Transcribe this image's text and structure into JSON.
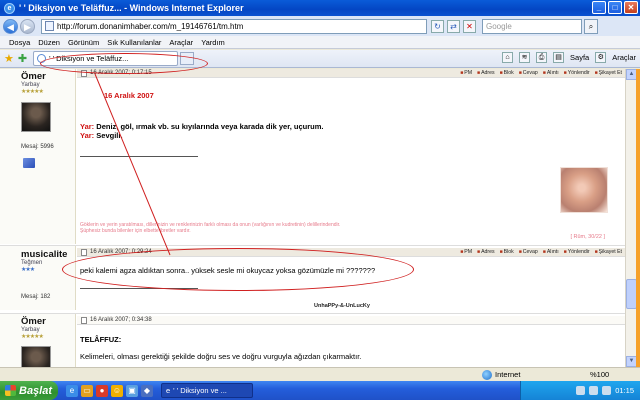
{
  "window": {
    "title": "' ' Diksiyon ve Teläffuz... - Windows Internet Explorer",
    "controls": [
      "_",
      "□",
      "✕"
    ]
  },
  "address": {
    "url": "http://forum.donanimhaber.com/m_19146761/tm.htm",
    "search_placeholder": "Google"
  },
  "menu": [
    "Dosya",
    "Düzen",
    "Görünüm",
    "Sık Kullanılanlar",
    "Araçlar",
    "Yardım"
  ],
  "tab": {
    "label": "' ' Diksiyon ve Teläffuz..."
  },
  "commands": {
    "page_label": "Sayfa",
    "tools_label": "Araçlar"
  },
  "post_actions": [
    "PM",
    "Adres",
    "Blok",
    "Cevap",
    "Alıntı",
    "Yönlendir",
    "Şikayet Et"
  ],
  "posts": [
    {
      "user": "Ömer",
      "rank": "Yarbay",
      "stars": "★★★★★",
      "messages": "Mesaj: 5996",
      "date": "16 Aralık 2007; 0:17:15",
      "date_title": "16 Aralık 2007",
      "line1_label": "Yar:",
      "line1_text": " Deniz, göl, ırmak vb. su kıyılarında veya karada dik yer, uçurum.",
      "line2_label": "Yar:",
      "line2_text": " Sevgili.",
      "sig_line1": "Göklerin ve yerin yaratılması, dillerinizin ve renklerinizin farklı olması da onun (varlığının ve kudretinin) delillerindendir.",
      "sig_line2": "Şüphesiz bunda bilenler için elbette ibretler vardır.",
      "sig_source": "[ Rûm, 30/22 ]"
    },
    {
      "user": "musicalite",
      "rank": "Teğmen",
      "stars": "★★★",
      "messages": "Mesaj: 182",
      "date": "16 Aralık 2007; 0:29:24",
      "body": "peki kalemi agza aldıktan sonra.. yüksek sesle mi okuycaz yoksa gözümüzle mi ???????",
      "signature": "UnhaPPy-&-UnLucKy"
    },
    {
      "user": "Ömer",
      "rank": "Yarbay",
      "stars": "★★★★★",
      "date": "16 Aralık 2007; 0:34:38",
      "heading": "TELÂFFUZ:",
      "body": "Kelimeleri, olması gerektiği şekilde doğru ses ve doğru vurguyla ağızdan çıkarmaktır."
    }
  ],
  "status": {
    "zone": "Internet",
    "zoom": "%100"
  },
  "taskbar": {
    "start": "Başlat",
    "task": "' ' Diksiyon ve ...",
    "clock": "01:15"
  }
}
